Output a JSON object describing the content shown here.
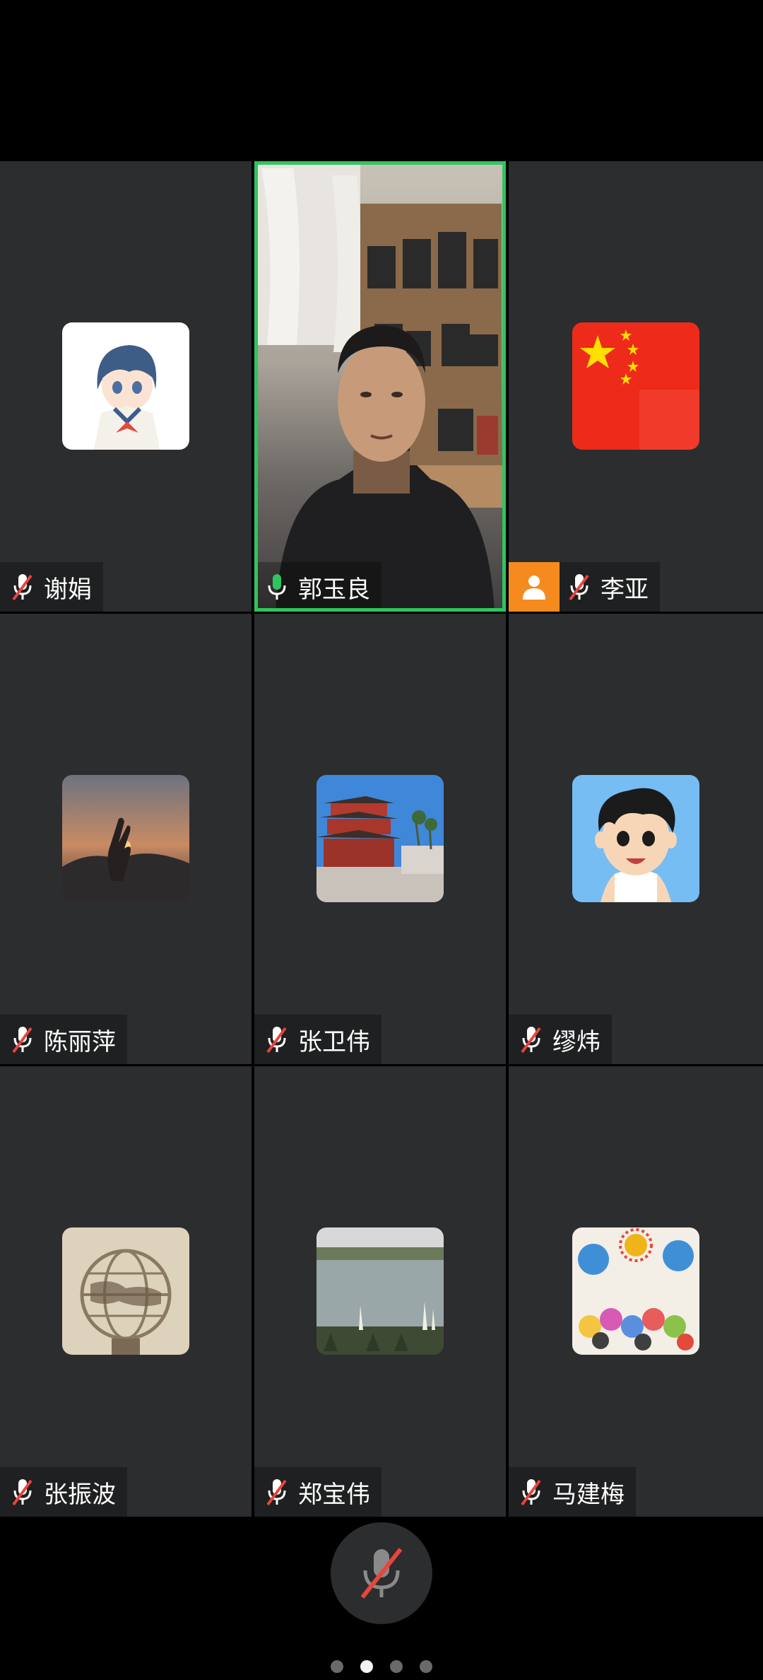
{
  "participants": [
    {
      "name": "谢娟",
      "mic": "muted",
      "avatar_icon": "anime-girl-avatar-icon",
      "colors": [
        "#ffffff",
        "#7fa9d6",
        "#e44b3f"
      ]
    },
    {
      "name": "郭玉良",
      "mic": "active",
      "avatar_icon": "camera-video-feed",
      "active_speaker": true
    },
    {
      "name": "李亚",
      "mic": "muted",
      "avatar_icon": "china-flag-avatar-icon",
      "host": true,
      "colors": [
        "#ee1c25",
        "#ffde00"
      ]
    },
    {
      "name": "陈丽萍",
      "mic": "muted",
      "avatar_icon": "sunset-hand-avatar-icon",
      "colors": [
        "#3b3a45",
        "#e27a3a"
      ]
    },
    {
      "name": "张卫伟",
      "mic": "muted",
      "avatar_icon": "pagoda-avatar-icon",
      "colors": [
        "#3f87d8",
        "#b33a2e"
      ]
    },
    {
      "name": "缪炜",
      "mic": "muted",
      "avatar_icon": "cartoon-boy-avatar-icon",
      "colors": [
        "#76bdf4",
        "#f7d6b8"
      ]
    },
    {
      "name": "张振波",
      "mic": "muted",
      "avatar_icon": "globe-sculpture-avatar-icon",
      "colors": [
        "#d9cdb4",
        "#8a7a62"
      ]
    },
    {
      "name": "郑宝伟",
      "mic": "muted",
      "avatar_icon": "lake-avatar-icon",
      "colors": [
        "#9aa7a8",
        "#6b7a5a"
      ]
    },
    {
      "name": "马建梅",
      "mic": "muted",
      "avatar_icon": "kids-drawing-avatar-icon",
      "colors": [
        "#f3eee6",
        "#3f8fd6"
      ]
    }
  ],
  "controls": {
    "mute_icon": "mic-muted-icon"
  },
  "pager": {
    "pages": 4,
    "current": 2
  },
  "theme": {
    "tile_bg": "#2c2d2f",
    "active_border": "#2fc55e",
    "host_badge": "#f58b1e",
    "mic_muted_red": "#e8453c",
    "mic_active_green": "#2fc55e"
  }
}
